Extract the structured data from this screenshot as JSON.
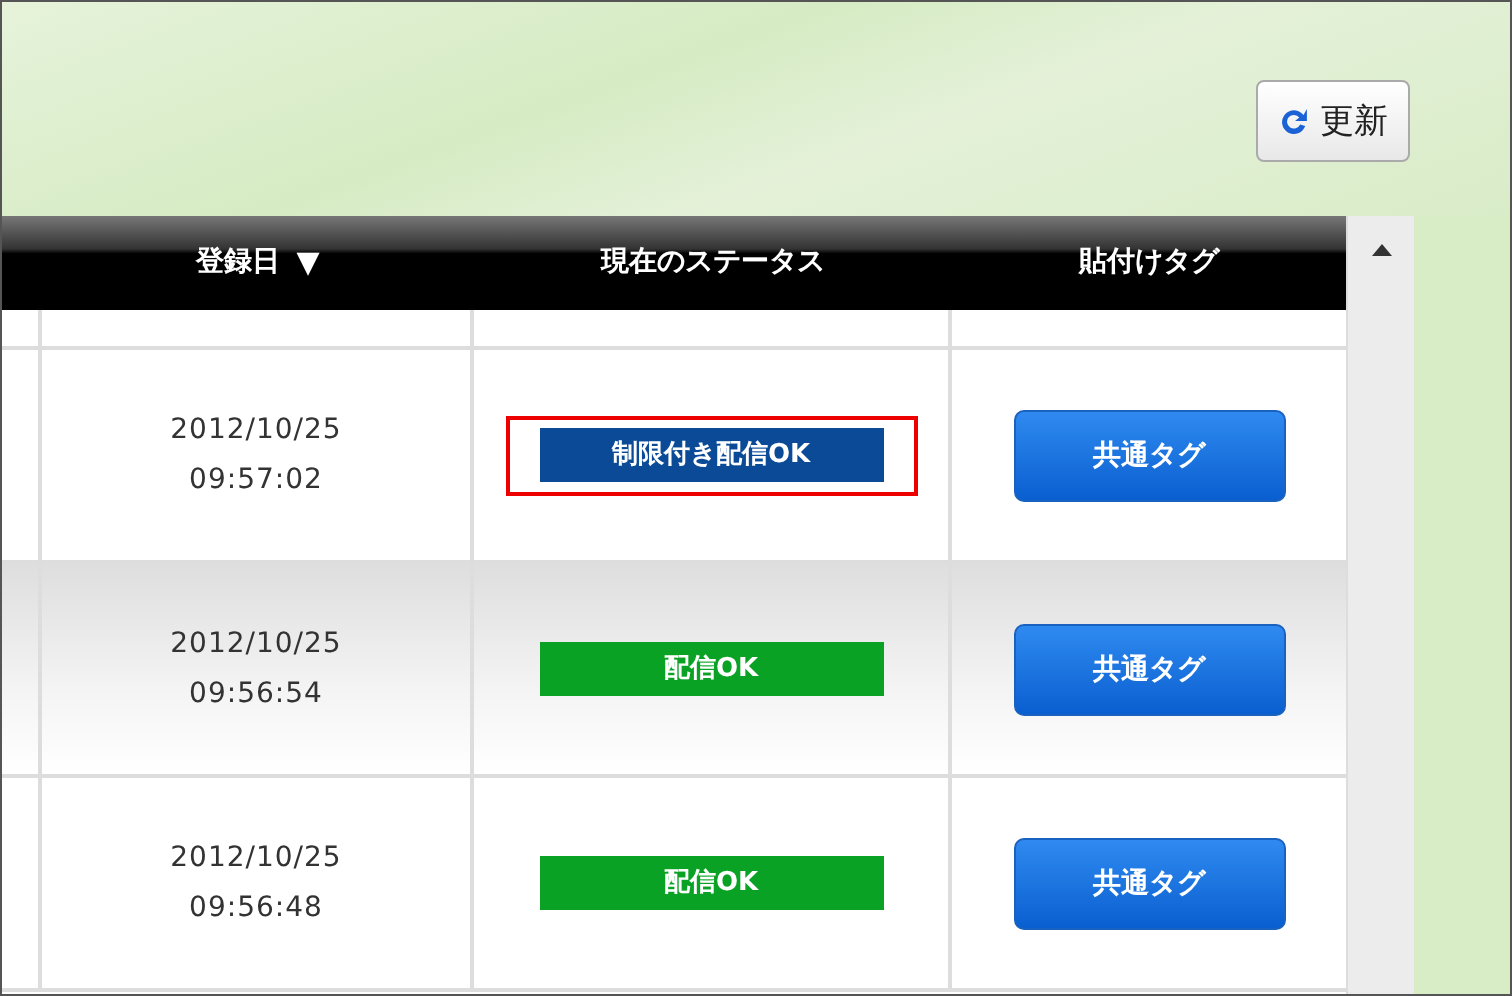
{
  "toolbar": {
    "refresh_button": "更新"
  },
  "table": {
    "columns": [
      {
        "label": "登録日",
        "sort_mark": "▼"
      },
      {
        "label": "現在のステータス"
      },
      {
        "label": "貼付けタグ"
      }
    ],
    "rows": [
      {
        "date": "2012/10/25",
        "time": "09:57:02",
        "status": {
          "kind": "restricted",
          "label": "制限付き配信OK",
          "outlined": true
        },
        "tag_button": "共通タグ",
        "selected": false
      },
      {
        "date": "2012/10/25",
        "time": "09:56:54",
        "status": {
          "kind": "ok",
          "label": "配信OK",
          "outlined": false
        },
        "tag_button": "共通タグ",
        "selected": true
      },
      {
        "date": "2012/10/25",
        "time": "09:56:48",
        "status": {
          "kind": "ok",
          "label": "配信OK",
          "outlined": false
        },
        "tag_button": "共通タグ",
        "selected": false
      }
    ]
  }
}
